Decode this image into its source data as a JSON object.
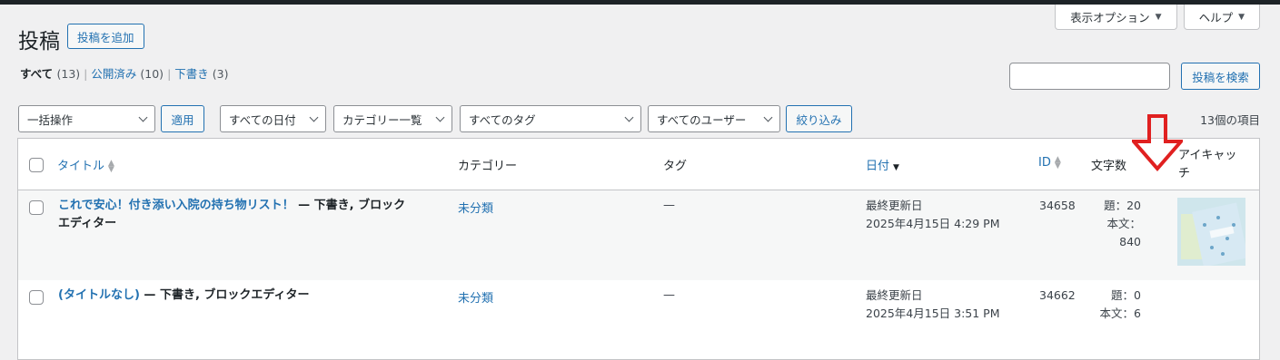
{
  "screen_options": {
    "display_options": "表示オプション",
    "help": "ヘルプ"
  },
  "header": {
    "title": "投稿",
    "add_new": "投稿を追加"
  },
  "views": [
    {
      "label": "すべて",
      "count": "(13)"
    },
    {
      "label": "公開済み",
      "count": "(10)"
    },
    {
      "label": "下書き",
      "count": "(3)"
    }
  ],
  "search": {
    "button": "投稿を検索",
    "value": ""
  },
  "filters": {
    "bulk_action": "一括操作",
    "apply": "適用",
    "date": "すべての日付",
    "category": "カテゴリー一覧",
    "tag": "すべてのタグ",
    "user": "すべてのユーザー",
    "filter_button": "絞り込み",
    "item_count": "13個の項目"
  },
  "columns": {
    "title": "タイトル",
    "category": "カテゴリー",
    "tag": "タグ",
    "date": "日付",
    "id": "ID",
    "word_count": "文字数",
    "eyecatch_line1": "アイキャッ",
    "eyecatch_line2": "チ"
  },
  "rows": [
    {
      "title_line1": "これで安心！付き添い入院の持ち物リスト！",
      "state_line1": " — 下書き, ブロック",
      "state_line2": "エディター",
      "category": "未分類",
      "tag": "—",
      "date_status": "最終更新日",
      "date": "2025年4月15日 4:29 PM",
      "id": "34658",
      "title_count": "題：20",
      "body_count": "本文：840"
    },
    {
      "title_line1": "(タイトルなし)",
      "state_line1": " — 下書き, ブロックエディター",
      "state_line2": "",
      "category": "未分類",
      "tag": "—",
      "date_status": "最終更新日",
      "date": "2025年4月15日 3:51 PM",
      "id": "34662",
      "title_count": "題：0",
      "body_count": "本文：6"
    }
  ],
  "colors": {
    "link": "#2271b1",
    "annotation_arrow": "#e02020",
    "admin_bar": "#1d2327"
  },
  "icons": [
    "sort-arrows-icon",
    "sort-desc-icon",
    "chevron-down-icon",
    "red-down-arrow-icon"
  ]
}
